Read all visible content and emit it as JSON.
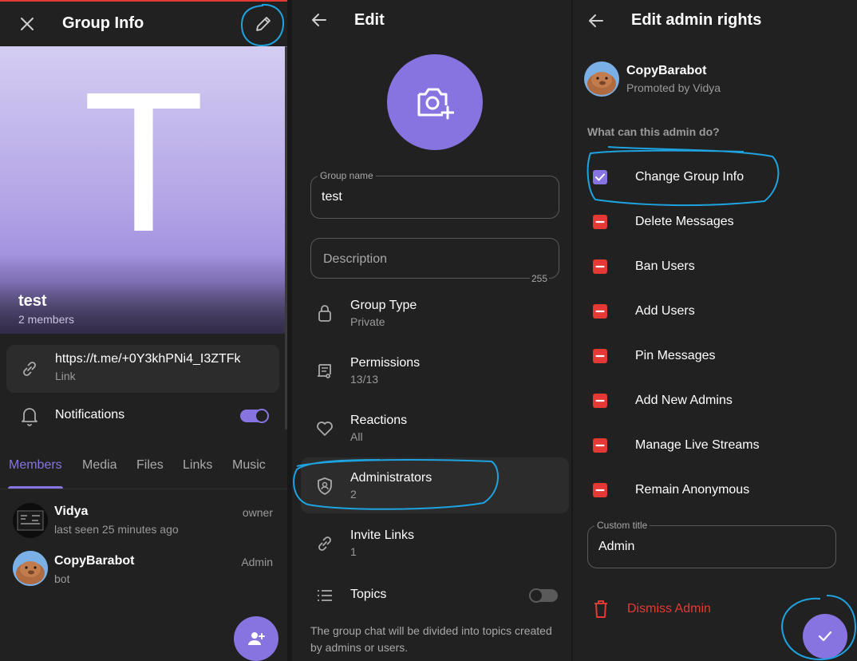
{
  "group_info": {
    "title": "Group Info",
    "group_name": "test",
    "members_count": "2 members",
    "avatar_letter": "T",
    "link": {
      "url": "https://t.me/+0Y3khPNi4_I3ZTFk",
      "label": "Link"
    },
    "notifications": {
      "label": "Notifications",
      "enabled": true
    },
    "tabs": [
      "Members",
      "Media",
      "Files",
      "Links",
      "Music"
    ],
    "active_tab": "Members",
    "members": [
      {
        "name": "Vidya",
        "status": "last seen 25 minutes ago",
        "role": "owner"
      },
      {
        "name": "CopyBarabot",
        "status": "bot",
        "role": "Admin"
      }
    ]
  },
  "edit": {
    "title": "Edit",
    "group_name_field": {
      "label": "Group name",
      "value": "test"
    },
    "description_field": {
      "placeholder": "Description",
      "counter": "255"
    },
    "items": [
      {
        "title": "Group Type",
        "sub": "Private",
        "icon": "lock-icon"
      },
      {
        "title": "Permissions",
        "sub": "13/13",
        "icon": "permissions-icon"
      },
      {
        "title": "Reactions",
        "sub": "All",
        "icon": "heart-icon"
      },
      {
        "title": "Administrators",
        "sub": "2",
        "icon": "shield-icon"
      },
      {
        "title": "Invite Links",
        "sub": "1",
        "icon": "link-icon"
      }
    ],
    "topics": {
      "label": "Topics",
      "enabled": false,
      "description": "The group chat will be divided into topics created by admins or users."
    }
  },
  "admin_rights": {
    "title": "Edit admin rights",
    "bot_name": "CopyBarabot",
    "promoted_by": "Promoted by Vidya",
    "section_header": "What can this admin do?",
    "rights": [
      {
        "label": "Change Group Info",
        "checked": true
      },
      {
        "label": "Delete Messages",
        "checked": false
      },
      {
        "label": "Ban Users",
        "checked": false
      },
      {
        "label": "Add Users",
        "checked": false
      },
      {
        "label": "Pin Messages",
        "checked": false
      },
      {
        "label": "Add New Admins",
        "checked": false
      },
      {
        "label": "Manage Live Streams",
        "checked": false
      },
      {
        "label": "Remain Anonymous",
        "checked": false
      }
    ],
    "custom_title": {
      "label": "Custom title",
      "value": "Admin"
    },
    "dismiss_label": "Dismiss Admin"
  },
  "colors": {
    "accent": "#8774e1",
    "danger": "#e53935",
    "panel_bg": "#212121",
    "annotation": "#1fa3e0"
  }
}
